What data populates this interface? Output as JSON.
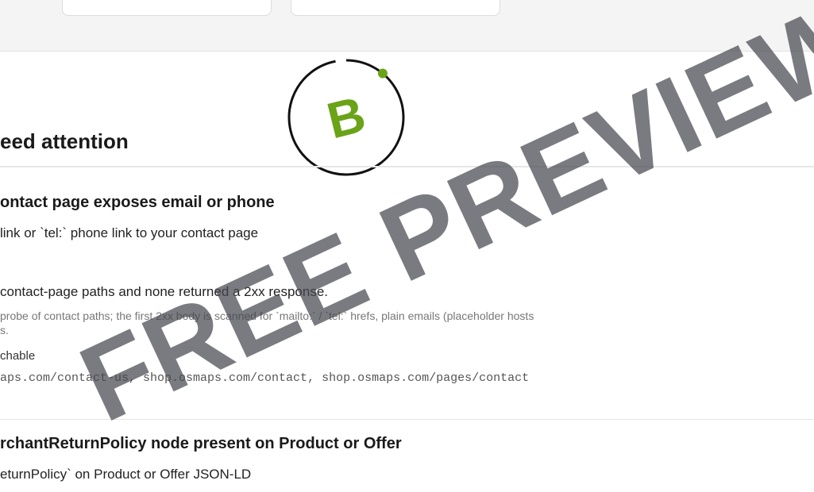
{
  "grade": {
    "letter": "B",
    "score_fraction": 0.97,
    "accent_color": "#6aa318",
    "ring_color": "#111111"
  },
  "section": {
    "title": "eed attention"
  },
  "checks": [
    {
      "title": "ontact page exposes email or phone",
      "fix": "link or `tel:` phone link to your contact page",
      "detail": "contact-page paths and none returned a 2xx response.",
      "method": "probe of contact paths; the first 2xx body is scanned for `mailto:` / `tel:` hrefs, plain emails (placeholder hosts",
      "method_cont": "s.",
      "status": "chable",
      "urls": "aps.com/contact-us, shop.osmaps.com/contact, shop.osmaps.com/pages/contact"
    },
    {
      "title": "rchantReturnPolicy node present on Product or Offer",
      "fix": "eturnPolicy` on Product or Offer JSON-LD"
    }
  ],
  "watermark": {
    "text": "FREE PREVIEW"
  }
}
